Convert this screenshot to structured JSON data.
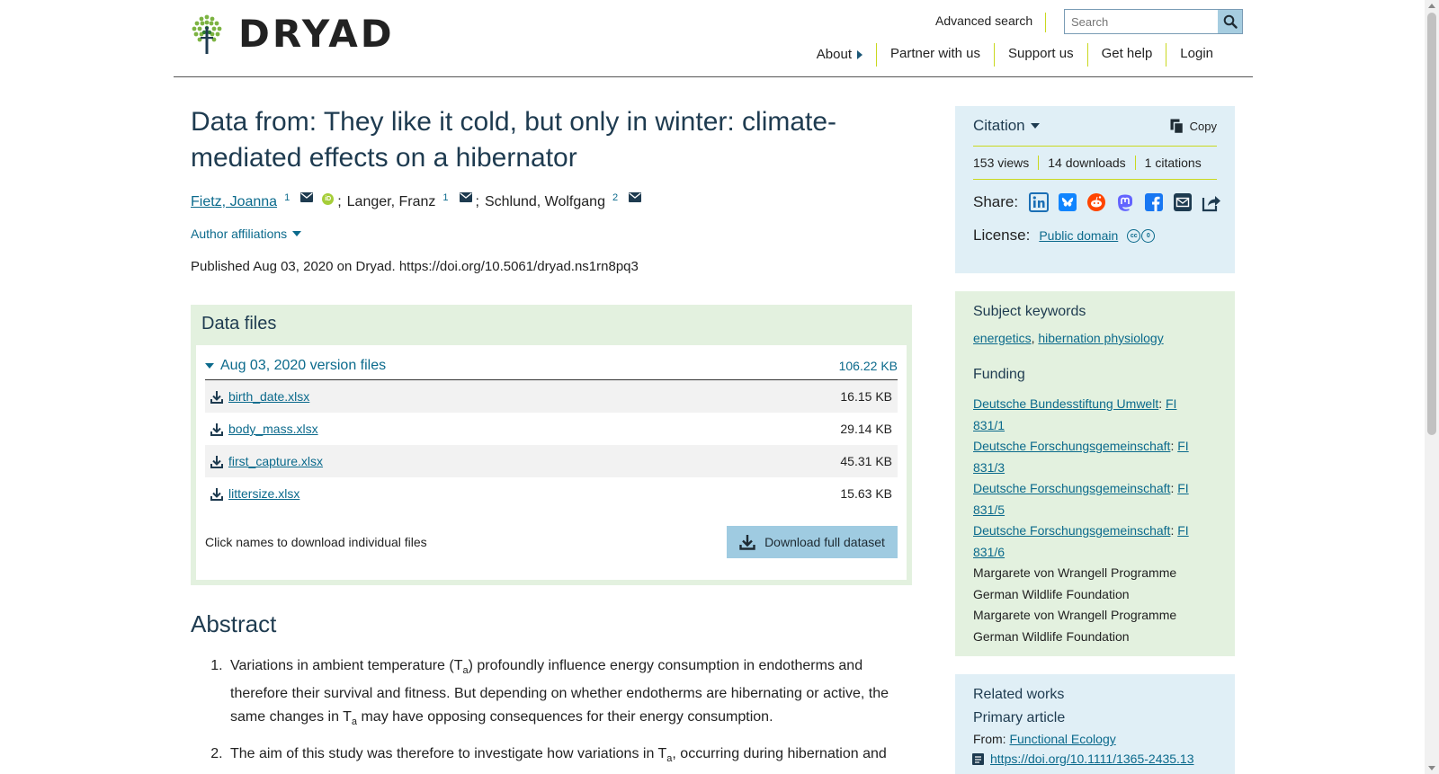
{
  "header": {
    "logo_text": "DRYAD",
    "advanced_search": "Advanced search",
    "search_placeholder": "Search",
    "nav": [
      "About",
      "Partner with us",
      "Support us",
      "Get help",
      "Login"
    ]
  },
  "dataset": {
    "title": "Data from: They like it cold, but only in winter: climate-mediated effects on a hibernator",
    "authors": [
      {
        "name": "Fietz, Joanna",
        "affil": "1",
        "linked": true,
        "orcid": true
      },
      {
        "name": "Langer, Franz",
        "affil": "1",
        "linked": false,
        "orcid": false
      },
      {
        "name": "Schlund, Wolfgang",
        "affil": "2",
        "linked": false,
        "orcid": false
      }
    ],
    "separator": ";",
    "author_affiliations_label": "Author affiliations",
    "published": "Published Aug 03, 2020 on Dryad. https://doi.org/10.5061/dryad.ns1rn8pq3"
  },
  "data_files": {
    "heading": "Data files",
    "version_label": "Aug 03, 2020 version files",
    "version_size": "106.22 KB",
    "files": [
      {
        "name": "birth_date.xlsx",
        "size": "16.15 KB"
      },
      {
        "name": "body_mass.xlsx",
        "size": "29.14 KB"
      },
      {
        "name": "first_capture.xlsx",
        "size": "45.31 KB"
      },
      {
        "name": "littersize.xlsx",
        "size": "15.63 KB"
      }
    ],
    "hint": "Click names to download individual files",
    "download_button": "Download full dataset"
  },
  "abstract": {
    "heading": "Abstract",
    "items": [
      {
        "before": "Variations in ambient temperature (T",
        "sub": "a",
        "mid": ") profoundly influence energy consumption in endotherms and therefore their survival and fitness. But depending on whether endotherms are hibernating or active, the same changes in T",
        "sub2": "a",
        "after": " may have opposing consequences for their energy consumption."
      },
      {
        "before": "The aim of this study was therefore to investigate how variations in T",
        "sub": "a",
        "mid": ", occurring during hibernation and",
        "sub2": "",
        "after": ""
      }
    ]
  },
  "sidebar": {
    "citation_label": "Citation",
    "copy_label": "Copy",
    "metrics": [
      "153 views",
      "14 downloads",
      "1 citations"
    ],
    "share_label": "Share:",
    "share_icons": [
      "linkedin-icon",
      "bluesky-icon",
      "reddit-icon",
      "mastodon-icon",
      "facebook-icon",
      "email-icon",
      "share-icon"
    ],
    "license_label": "License:",
    "license_value": "Public domain",
    "keywords_heading": "Subject keywords",
    "keywords": [
      "energetics",
      "hibernation physiology"
    ],
    "funding_heading": "Funding",
    "funding": [
      {
        "org": "Deutsche Bundesstiftung Umwelt",
        "award_line1": "FI",
        "award_line2": "831/1"
      },
      {
        "org": "Deutsche Forschungsgemeinschaft",
        "award_line1": "FI",
        "award_line2": "831/3"
      },
      {
        "org": "Deutsche Forschungsgemeinschaft",
        "award_line1": "FI",
        "award_line2": "831/5"
      },
      {
        "org": "Deutsche Forschungsgemeinschaft",
        "award_line1": "FI",
        "award_line2": "831/6"
      }
    ],
    "funding_plain": [
      "Margarete von Wrangell Programme",
      "German Wildlife Foundation",
      "Margarete von Wrangell Programme",
      "German Wildlife Foundation"
    ],
    "related_heading": "Related works",
    "primary_article_heading": "Primary article",
    "from_label": "From:",
    "journal": "Functional Ecology",
    "related_doi": "https://doi.org/10.1111/1365-2435.13"
  },
  "colors": {
    "accent_link": "#0b6a8c",
    "heading": "#1e3b50",
    "green_panel": "#e3f1df",
    "blue_panel": "#e0eff6",
    "divider_lime": "#c9d81f",
    "download_button": "#9fcbe1"
  }
}
